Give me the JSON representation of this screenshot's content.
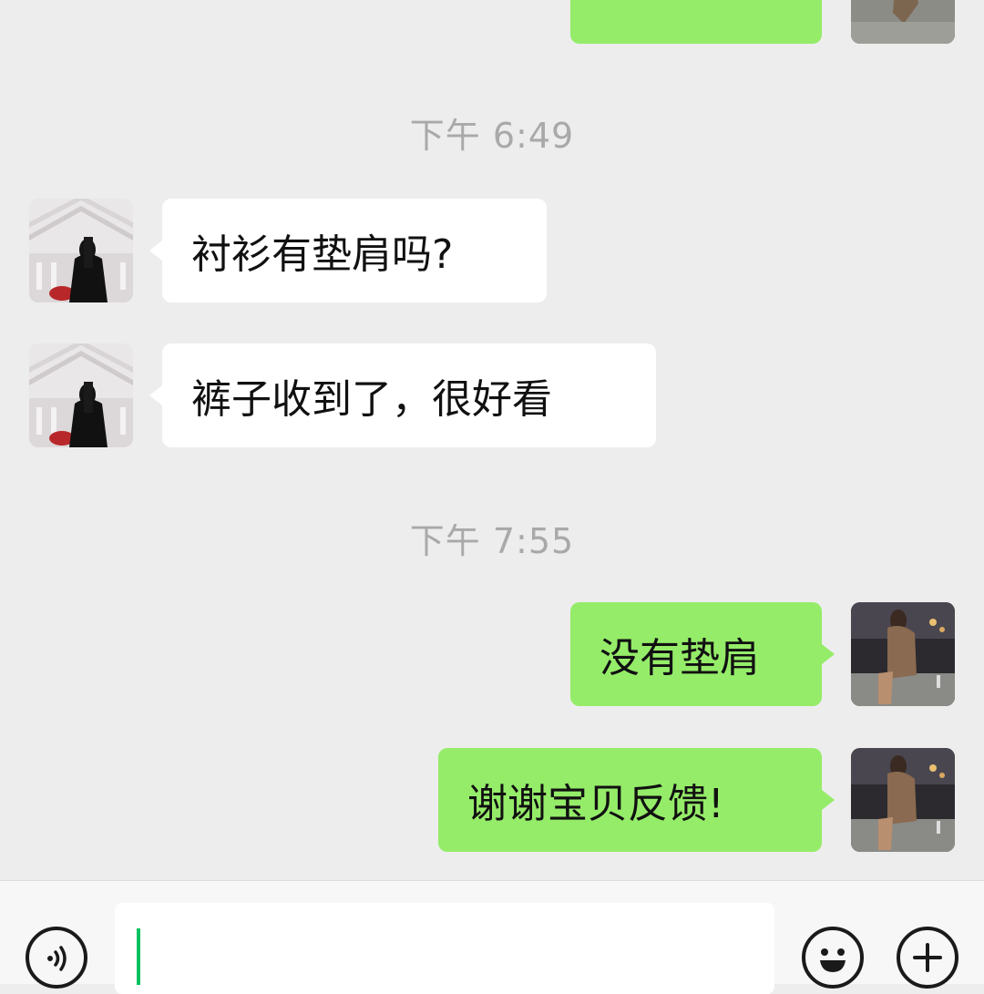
{
  "messages": [
    {
      "side": "out",
      "text": ""
    },
    {
      "side": "time",
      "text": "下午 6:49"
    },
    {
      "side": "in",
      "text": "衬衫有垫肩吗?"
    },
    {
      "side": "in",
      "text": "裤子收到了，很好看"
    },
    {
      "side": "time",
      "text": "下午 7:55"
    },
    {
      "side": "out",
      "text": "没有垫肩"
    },
    {
      "side": "out",
      "text": "谢谢宝贝反馈!"
    }
  ],
  "input": {
    "value": ""
  },
  "icons": {
    "voice": "voice-icon",
    "emoji": "emoji-icon",
    "more": "plus-icon"
  },
  "colors": {
    "background": "#ededed",
    "incoming_bubble": "#ffffff",
    "outgoing_bubble": "#95ec69",
    "timestamp": "#a9a9a9",
    "caret": "#07c160"
  }
}
